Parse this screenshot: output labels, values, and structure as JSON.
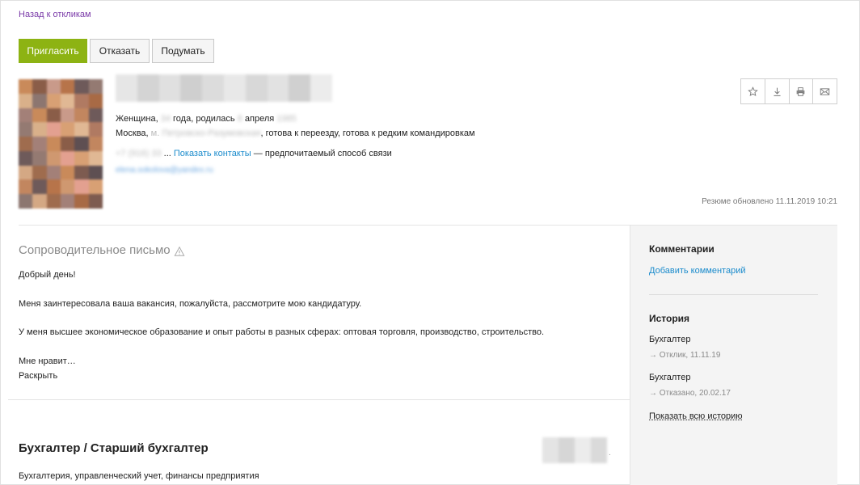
{
  "nav": {
    "back_label": "Назад к откликам"
  },
  "actions": {
    "invite": "Пригласить",
    "reject": "Отказать",
    "think": "Подумать"
  },
  "profile": {
    "gender_age_prefix": "Женщина, ",
    "age_blurred": "34",
    "age_suffix": " года, родилась ",
    "birth_day_blurred": "8",
    "birth_month": " апреля ",
    "birth_year_blurred": "1985",
    "city": "Москва, ",
    "metro_prefix": "м. ",
    "metro_blurred": "Петровско-Разумовская",
    "relocation": ", готова к переезду, готова к редким командировкам",
    "phone_blurred": "+7 (916) 33",
    "phone_ellipsis": " ... ",
    "show_contacts": "Показать контакты",
    "preferred_contact": " — предпочитаемый способ связи",
    "email_blurred": "elena.sokolova@yandex.ru",
    "updated": "Резюме обновлено 11.11.2019 10:21"
  },
  "tools": {
    "favorite_icon": "star-icon",
    "download_icon": "download-icon",
    "print_icon": "print-icon",
    "mail_icon": "mail-icon"
  },
  "cover_letter": {
    "title": "Сопроводительное письмо",
    "greeting": "Добрый день!",
    "p1": "Меня заинтересовала ваша вакансия, пожалуйста, рассмотрите мою кандидатуру.",
    "p2": "У меня высшее экономическое образование и опыт работы в разных сферах: оптовая торговля, производство, строительство.",
    "p3": "Мне нравит…",
    "expand": "Раскрыть"
  },
  "sidebar": {
    "comments_title": "Комментарии",
    "add_comment": "Добавить комментарий",
    "history_title": "История",
    "history": [
      {
        "position": "Бухгалтер",
        "status": "→ Отклик, 11.11.19"
      },
      {
        "position": "Бухгалтер",
        "status": "→ Отказано, 20.02.17"
      }
    ],
    "show_all": "Показать всю историю"
  },
  "resume": {
    "position_title": "Бухгалтер / Старший бухгалтер",
    "specialization": "Бухгалтерия, управленческий учет, финансы предприятия",
    "salary_suffix": "."
  },
  "colors": {
    "accent_green": "#8db313",
    "link_blue": "#1a8bcc",
    "back_purple": "#7a3aa8"
  }
}
